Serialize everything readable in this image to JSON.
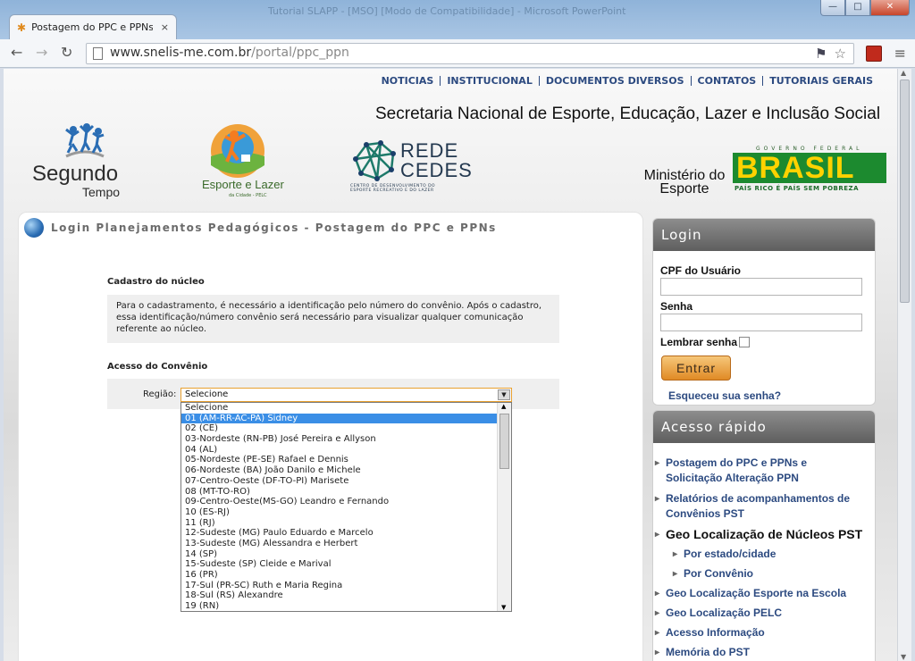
{
  "window": {
    "title": "Tutorial SLAPP - [MSO] [Modo de Compatibilidade] - Microsoft PowerPoint",
    "tab_title": "Postagem do PPC e PPNs",
    "tab_close": "×",
    "buttons": {
      "minimize": "—",
      "maximize": "□",
      "close": "✕"
    }
  },
  "browser": {
    "url_host": "www.snelis-me.com.br",
    "url_path": "/portal/ppc_ppn"
  },
  "topnav": [
    "NOTICIAS",
    "INSTITUCIONAL",
    "DOCUMENTOS DIVERSOS",
    "CONTATOS",
    "TUTORIAIS GERAIS"
  ],
  "header": {
    "secretaria": "Secretaria Nacional de Esporte, Educação, Lazer e Inclusão Social",
    "logo_segundo": "Segundo",
    "logo_tempo": "Tempo",
    "logo_esporte": "Esporte e Lazer",
    "logo_esporte_sub": "da Cidade - PELC",
    "logo_rede": "REDE CEDES",
    "logo_rede_sub": "CENTRO DE DESENVOLVIMENTO DO ESPORTE RECREATIVO E DO LAZER",
    "ministerio": "Ministério do Esporte",
    "gov_federal": "GOVERNO FEDERAL",
    "brasil": "BRASIL",
    "brasil_sub": "PAÍS RICO É PAÍS SEM POBREZA"
  },
  "main": {
    "title": "Login Planejamentos Pedagógicos - Postagem do PPC e PPNs",
    "cadastro_label": "Cadastro do núcleo",
    "cadastro_text": "Para o cadastramento, é necessário a identificação pelo número do convênio. Após o cadastro, essa identificação/número convênio será necessário para visualizar qualquer comunicação referente ao núcleo.",
    "acesso_label": "Acesso do Convênio",
    "regiao_label": "Região:",
    "regiao_value": "Selecione",
    "regiao_options": [
      "Selecione",
      "01 (AM-RR-AC-PA) Sidney",
      "02 (CE)",
      "03-Nordeste (RN-PB) José Pereira e Allyson",
      "04 (AL)",
      "05-Nordeste (PE-SE) Rafael e Dennis",
      "06-Nordeste (BA) João Danilo e Michele",
      "07-Centro-Oeste (DF-TO-PI) Marisete",
      "08 (MT-TO-RO)",
      "09-Centro-Oeste(MS-GO) Leandro e Fernando",
      "10 (ES-RJ)",
      "11 (RJ)",
      "12-Sudeste (MG) Paulo Eduardo e Marcelo",
      "13-Sudeste (MG) Alessandra e Herbert",
      "14 (SP)",
      "15-Sudeste (SP) Cleide e Marival",
      "16 (PR)",
      "17-Sul (PR-SC) Ruth e Maria Regina",
      "18-Sul (RS) Alexandre",
      "19 (RN)"
    ],
    "selected_option": "01 (AM-RR-AC-PA) Sidney"
  },
  "login": {
    "title": "Login",
    "cpf_label": "CPF do Usuário",
    "senha_label": "Senha",
    "lembrar_label": "Lembrar senha",
    "entrar": "Entrar",
    "esqueceu": "Esqueceu sua senha?"
  },
  "rapido": {
    "title": "Acesso rápido",
    "links": [
      "Postagem do PPC e PPNs e Solicitação Alteração PPN",
      "Relatórios de acompanhamentos de Convênios PST",
      "Geo Localização de Núcleos PST",
      "Por estado/cidade",
      "Por Convênio",
      "Geo Localização Esporte na Escola",
      "Geo Localização PELC",
      "Acesso Informação",
      "Memória do PST"
    ]
  },
  "colors": {
    "link": "#2c4a80",
    "selected": "#3a8ee6",
    "button": "#e08a25",
    "brasil_green": "#1c8a2f",
    "brasil_yellow": "#ffd200"
  }
}
